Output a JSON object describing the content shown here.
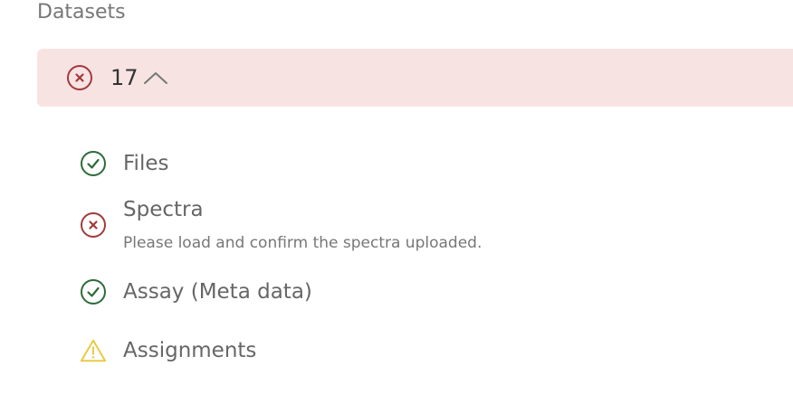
{
  "section": {
    "title": "Datasets"
  },
  "summary": {
    "count": "17",
    "status": "error",
    "expanded": true,
    "background": "#f8e3e3",
    "error_color": "#a33a3a"
  },
  "items": [
    {
      "label": "Files",
      "status": "success",
      "icon": "check-circle-icon",
      "description": ""
    },
    {
      "label": "Spectra",
      "status": "error",
      "icon": "x-circle-icon",
      "description": "Please load and confirm the spectra uploaded."
    },
    {
      "label": "Assay (Meta data)",
      "status": "success",
      "icon": "check-circle-icon",
      "description": ""
    },
    {
      "label": "Assignments",
      "status": "warning",
      "icon": "warning-triangle-icon",
      "description": ""
    }
  ],
  "colors": {
    "success": "#2e6b3a",
    "error": "#a33a3a",
    "warning": "#e8c83a"
  }
}
